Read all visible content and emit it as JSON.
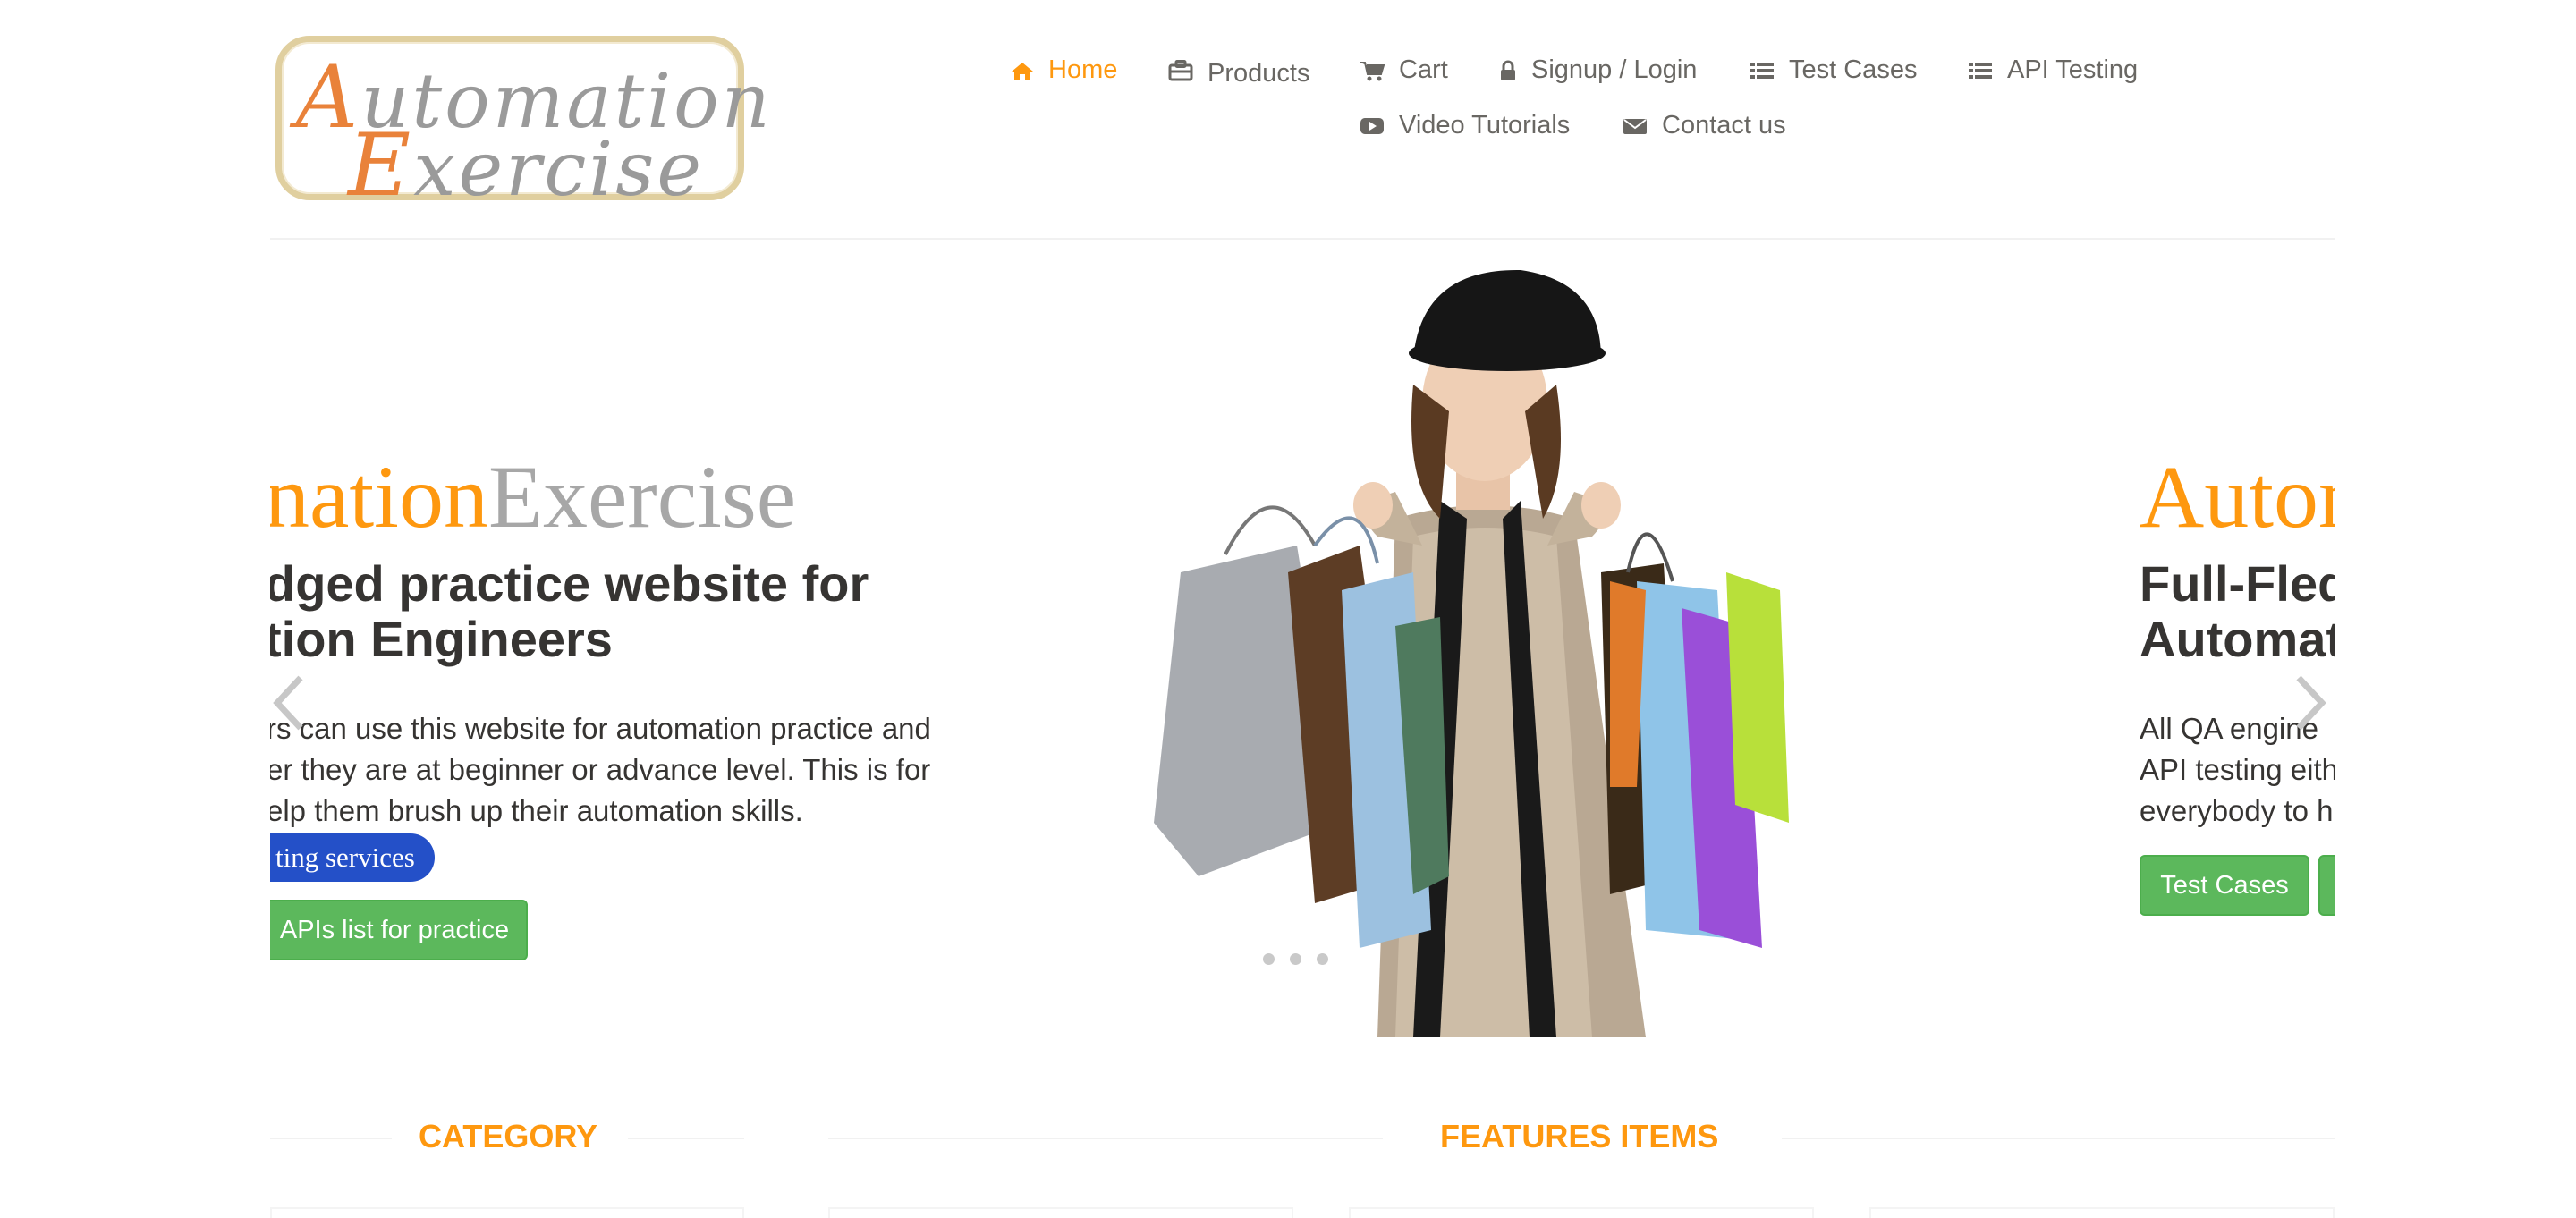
{
  "logo": {
    "line1_cap": "A",
    "line1_rest": "utomation",
    "line2_cap": "E",
    "line2_rest": "xercise"
  },
  "nav": {
    "items": [
      {
        "label": "Home",
        "icon": "home-icon",
        "active": true
      },
      {
        "label": "Products",
        "icon": "briefcase-icon"
      },
      {
        "label": "Cart",
        "icon": "cart-icon"
      },
      {
        "label": "Signup / Login",
        "icon": "lock-icon"
      },
      {
        "label": "Test Cases",
        "icon": "list-icon"
      },
      {
        "label": "API Testing",
        "icon": "list-icon"
      },
      {
        "label": "Video Tutorials",
        "icon": "youtube-icon"
      },
      {
        "label": "Contact us",
        "icon": "envelope-icon"
      }
    ]
  },
  "slider": {
    "left_slide": {
      "brand_orange": "nation",
      "brand_gray": "Exercise",
      "heading_line1": "dged practice website for",
      "heading_line2": "tion Engineers",
      "desc_line1": "rs can use this website for automation practice and",
      "desc_line2": "er they are at beginner or advance level. This is for",
      "desc_line3": "elp them brush up their automation skills.",
      "pill": "ting services",
      "button": "APIs list for practice"
    },
    "right_slide": {
      "brand_orange": "Autom",
      "heading_line1": "Full-Fled",
      "heading_line2": "Automat",
      "desc_line1": "All QA engine",
      "desc_line2": "API testing eith",
      "desc_line3": "everybody to h",
      "button": "Test Cases"
    },
    "indicators": 3,
    "prev_icon": "chevron-left-icon",
    "next_icon": "chevron-right-icon"
  },
  "sections": {
    "category_title": "CATEGORY",
    "features_title": "FEATURES ITEMS"
  },
  "colors": {
    "accent": "#fe980f",
    "nav_text": "#696763",
    "green": "#5cb85c",
    "pill_blue": "#2450c8",
    "heading": "#363432"
  }
}
